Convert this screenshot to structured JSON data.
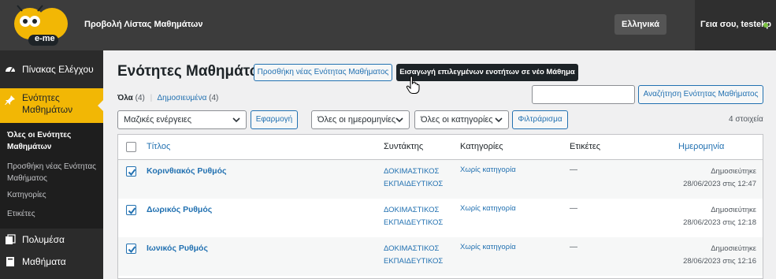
{
  "topbar": {
    "site_title": "Προβολή Λίστας Μαθημάτων",
    "logo_text": "e-me",
    "language": "Ελληνικά",
    "greeting": "Γεια σου, testekp"
  },
  "sidebar": {
    "items": [
      {
        "label": "Πίνακας Ελέγχου",
        "icon": "dashboard-icon"
      },
      {
        "label": "Ενότητες Μαθημάτων",
        "icon": "pin-icon"
      },
      {
        "label": "Πολυμέσα",
        "icon": "media-icon"
      },
      {
        "label": "Μαθήματα",
        "icon": "lessons-icon"
      }
    ],
    "submenu": [
      {
        "label": "Όλες οι Ενότητες Μαθημάτων",
        "current": true
      },
      {
        "label": "Προσθήκη νέας Ενότητας Μαθήματος"
      },
      {
        "label": "Κατηγορίες"
      },
      {
        "label": "Ετικέτες"
      }
    ]
  },
  "main": {
    "title": "Ενότητες Μαθημάτων",
    "add_new_label": "Προσθήκη νέας Ενότητας Μαθήματος",
    "import_label": "Εισαγωγή επιλεγμένων ενοτήτων σε νέο Μάθημα",
    "filters": {
      "all_label": "Όλα",
      "all_count": "(4)",
      "separator": "|",
      "published_label": "Δημοσιευμένα",
      "published_count": "(4)"
    },
    "search": {
      "value": "",
      "button_label": "Αναζήτηση Ενότητας Μαθήματος"
    },
    "bulk_actions": {
      "selected": "Μαζικές ενέργειες",
      "apply_label": "Εφαρμογή"
    },
    "date_filter": {
      "selected": "Όλες οι ημερομηνίες"
    },
    "category_filter": {
      "selected": "Όλες οι κατηγορίες"
    },
    "filter_label": "Φιλτράρισμα",
    "items_count": "4 στοιχεία"
  },
  "table": {
    "columns": [
      "Τίτλος",
      "Συντάκτης",
      "Κατηγορίες",
      "Ετικέτες",
      "Ημερομηνία"
    ],
    "rows": [
      {
        "title": "Κορινθιακός Ρυθμός",
        "author_line1": "ΔΟΚΙΜΑΣΤΙΚΟΣ",
        "author_line2": "ΕΚΠΑΙΔΕΥΤΙΚΟΣ",
        "category": "Χωρίς κατηγορία",
        "tags": "—",
        "status": "Δημοσιεύτηκε",
        "date": "28/06/2023 στις 12:47",
        "checked": true
      },
      {
        "title": "Δωρικός Ρυθμός",
        "author_line1": "ΔΟΚΙΜΑΣΤΙΚΟΣ",
        "author_line2": "ΕΚΠΑΙΔΕΥΤΙΚΟΣ",
        "category": "Χωρίς κατηγορία",
        "tags": "—",
        "status": "Δημοσιεύτηκε",
        "date": "28/06/2023 στις 12:18",
        "checked": true
      },
      {
        "title": "Ιωνικός Ρυθμός",
        "author_line1": "ΔΟΚΙΜΑΣΤΙΚΟΣ",
        "author_line2": "ΕΚΠΑΙΔΕΥΤΙΚΟΣ",
        "category": "Χωρίς κατηγορία",
        "tags": "—",
        "status": "Δημοσιεύτηκε",
        "date": "28/06/2023 στις 12:16",
        "checked": true
      }
    ]
  },
  "colors": {
    "accent": "#f2b705",
    "link": "#2271b1",
    "topbar": "#3c3c3c",
    "sidebar": "#2b2b2b",
    "status_online": "#7ac142"
  }
}
